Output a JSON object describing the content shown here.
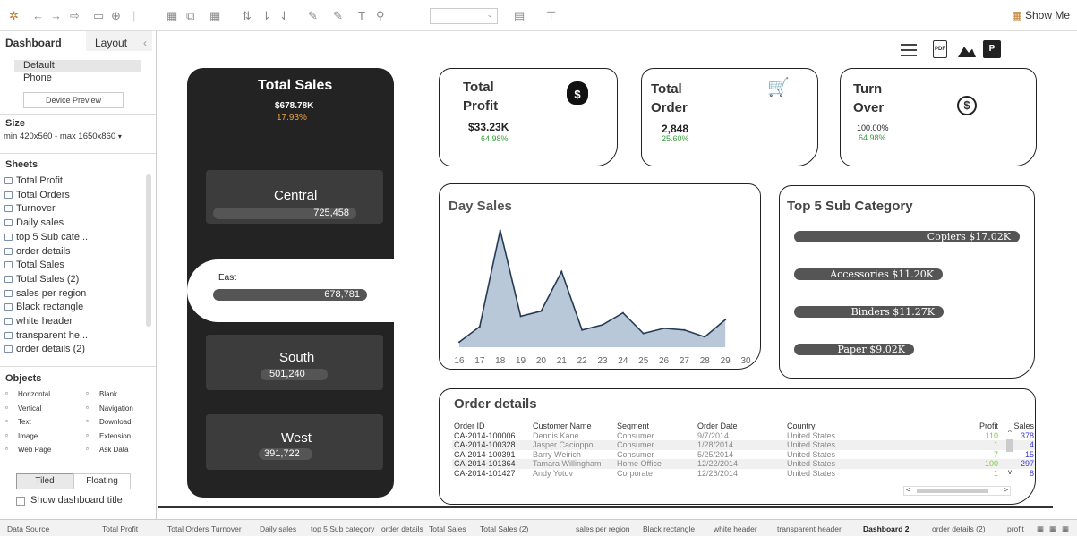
{
  "toolbar": {
    "show_me": "Show Me"
  },
  "left_panel": {
    "tabs": [
      "Dashboard",
      "Layout"
    ],
    "devices": [
      "Default",
      "Phone"
    ],
    "device_preview": "Device Preview",
    "size_label": "Size",
    "size_value": "min 420x560 - max 1650x860",
    "sheets_label": "Sheets",
    "sheets": [
      "Total Profit",
      "Total Orders",
      "Turnover",
      "Daily sales",
      "top 5 Sub cate...",
      "order details",
      "Total Sales",
      "Total Sales (2)",
      "sales per region",
      "Black rectangle",
      "white header",
      "transparent he...",
      "order details (2)"
    ],
    "objects_label": "Objects",
    "objects_left": [
      "Horizontal",
      "Vertical",
      "Text",
      "Image",
      "Web Page"
    ],
    "objects_right": [
      "Blank",
      "Navigation",
      "Download",
      "Extension",
      "Ask Data"
    ],
    "tiled": "Tiled",
    "floating": "Floating",
    "show_title": "Show dashboard title"
  },
  "status_tabs": [
    "Data Source",
    "Total Profit",
    "Total Orders",
    "Turnover",
    "Daily sales",
    "top 5 Sub category",
    "order details",
    "Total Sales",
    "Total Sales (2)",
    "sales per region",
    "Black rectangle",
    "white header",
    "transparent header",
    "Dashboard 2",
    "order details (2)",
    "profit"
  ],
  "total_sales": {
    "title": "Total Sales",
    "value": "$678.78K",
    "pct": "17.93%"
  },
  "regions": [
    {
      "name": "Central",
      "value": "725,458"
    },
    {
      "name": "East",
      "value": "678,781"
    },
    {
      "name": "South",
      "value": "501,240"
    },
    {
      "name": "West",
      "value": "391,722"
    }
  ],
  "kpis": {
    "profit": {
      "title1": "Total",
      "title2": "Profit",
      "value": "$33.23K",
      "pct": "64.98%"
    },
    "order": {
      "title1": "Total",
      "title2": "Order",
      "value": "2,848",
      "pct": "25.60%"
    },
    "turnover": {
      "title1": "Turn",
      "title2": "Over",
      "value": "100.00%",
      "pct": "64.98%"
    }
  },
  "day_sales_title": "Day Sales",
  "top5_title": "Top 5 Sub Category",
  "chart_data": [
    {
      "type": "area",
      "title": "Day Sales",
      "x": [
        16,
        17,
        18,
        19,
        20,
        21,
        22,
        23,
        24,
        25,
        26,
        27,
        28,
        29,
        30
      ],
      "values": [
        3,
        12,
        68,
        18,
        21,
        44,
        10,
        13,
        20,
        8,
        11,
        10,
        6,
        16,
        null
      ],
      "ylim": [
        0,
        75
      ],
      "grid": false,
      "fill": "#b8c8d9",
      "stroke": "#253a54"
    },
    {
      "type": "bar",
      "title": "Top 5 Sub Category",
      "categories": [
        "Copiers",
        "Accessories",
        "Binders",
        "Paper"
      ],
      "values": [
        17.02,
        11.2,
        11.27,
        9.02
      ],
      "labels": [
        "Copiers $17.02K",
        "Accessories $11.20K",
        "Binders $11.27K",
        "Paper $9.02K"
      ]
    }
  ],
  "orders": {
    "title": "Order details",
    "columns": [
      "Order ID",
      "Customer Name",
      "Segment",
      "Order Date",
      "Country",
      "Profit",
      "Sales"
    ],
    "rows": [
      [
        "CA-2014-100006",
        "Dennis Kane",
        "Consumer",
        "9/7/2014",
        "United States",
        "110",
        "378"
      ],
      [
        "CA-2014-100328",
        "Jasper Cacioppo",
        "Consumer",
        "1/28/2014",
        "United States",
        "1",
        "4"
      ],
      [
        "CA-2014-100391",
        "Barry Weirich",
        "Consumer",
        "5/25/2014",
        "United States",
        "7",
        "15"
      ],
      [
        "CA-2014-101364",
        "Tamara Willingham",
        "Home Office",
        "12/22/2014",
        "United States",
        "100",
        "297"
      ],
      [
        "CA-2014-101427",
        "Andy Yotov",
        "Corporate",
        "12/26/2014",
        "United States",
        "1",
        "8"
      ]
    ]
  },
  "colors": {
    "profit_green": "#7acc3c",
    "sales_blue": "#3b3bd6",
    "accent_orange": "#e8a34a",
    "panel_black": "#232323"
  }
}
